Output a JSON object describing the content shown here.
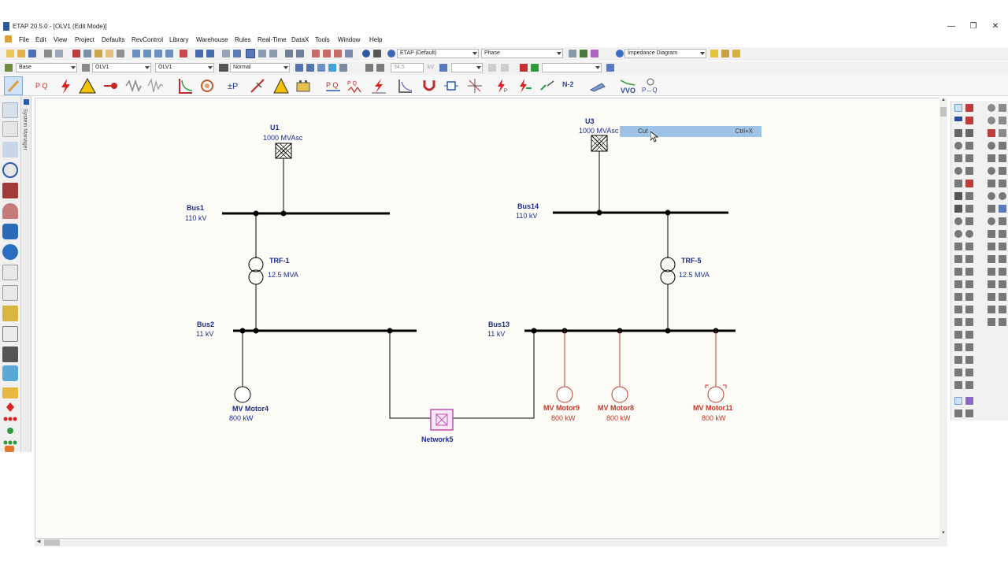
{
  "window": {
    "title": "ETAP 20.5.0 - [OLV1 (Edit Mode)]"
  },
  "menu": {
    "items": [
      "File",
      "Edit",
      "View",
      "Project",
      "Defaults",
      "RevControl",
      "Library",
      "Warehouse",
      "Rules",
      "Real-Time",
      "DataX",
      "Tools",
      "Window",
      "Help"
    ]
  },
  "toolbar1": {
    "config_combo": "ETAP (Default)",
    "phase_combo": "Phase",
    "diagram_combo": "Impedance Diagram"
  },
  "toolbar2": {
    "base_combo": "Base",
    "olv_combo1": "OLV1",
    "olv_combo2": "OLV1",
    "normal_combo": "Normal",
    "kv_value": "34.5",
    "kv_unit": "kV"
  },
  "toolbar3": {
    "n2_label": "N-2",
    "vvo_label": "VVO",
    "pq_label": "P↔Q"
  },
  "system_manager": {
    "label": "System Manager"
  },
  "context_menu": {
    "item_label": "Cut",
    "shortcut": "Ctrl+X"
  },
  "diagram": {
    "utilities": [
      {
        "id": "U1",
        "rating": "1000 MVAsc"
      },
      {
        "id": "U3",
        "rating": "1000 MVAsc"
      }
    ],
    "buses": [
      {
        "id": "Bus1",
        "kv": "110 kV"
      },
      {
        "id": "Bus14",
        "kv": "110 kV"
      },
      {
        "id": "Bus2",
        "kv": "11 kV"
      },
      {
        "id": "Bus13",
        "kv": "11 kV"
      }
    ],
    "transformers": [
      {
        "id": "TRF-1",
        "rating": "12.5 MVA"
      },
      {
        "id": "TRF-5",
        "rating": "12.5 MVA"
      }
    ],
    "motors": [
      {
        "id": "MV Motor4",
        "rating": "800 kW"
      },
      {
        "id": "MV Motor9",
        "rating": "800 kW"
      },
      {
        "id": "MV Motor8",
        "rating": "800 kW"
      },
      {
        "id": "MV Motor11",
        "rating": "800 kW"
      }
    ],
    "network": {
      "id": "Network5"
    },
    "colors": {
      "label_blue": "#1a2d8c",
      "deenergized_red": "#c0392b",
      "network_pink": "#c04fb5",
      "bus_black": "#000000"
    }
  }
}
